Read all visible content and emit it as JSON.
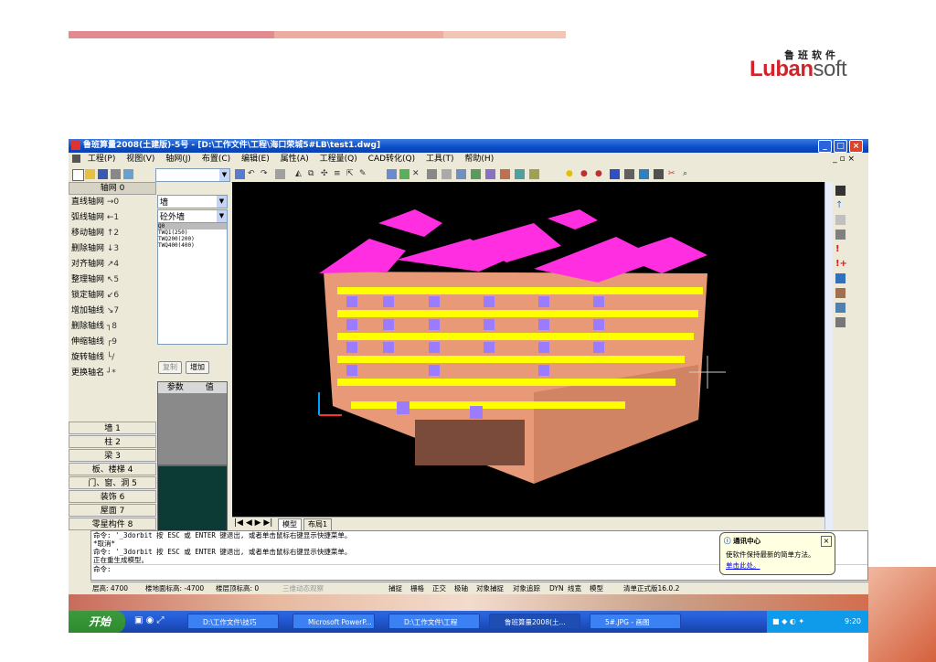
{
  "slide": {
    "logo_cn": "鲁班软件",
    "logo_en_bold": "Luban",
    "logo_en_light": "soft",
    "stripe_colors": [
      "#e0808a",
      "#eba8a0",
      "#f2c8b8",
      "#f6ddd0"
    ]
  },
  "window": {
    "title": "鲁班算量2008(土建版)-5号 - [D:\\工作文件\\工程\\海口荣城5#LB\\test1.dwg]",
    "controls": [
      "_",
      "□",
      "×"
    ]
  },
  "menu": [
    "工程(P)",
    "视图(V)",
    "轴网(J)",
    "布置(C)",
    "编辑(E)",
    "属性(A)",
    "工程量(Q)",
    "CAD转化(Q)",
    "工具(T)",
    "帮助(H)"
  ],
  "toolbar": {
    "layer_combo": ""
  },
  "left_panel": {
    "header": "轴网 0",
    "items": [
      {
        "label": "直线轴网",
        "key": "→0"
      },
      {
        "label": "弧线轴网",
        "key": "←1"
      },
      {
        "label": "移动轴网",
        "key": "↑2"
      },
      {
        "label": "删除轴网",
        "key": "↓3"
      },
      {
        "label": "对齐轴网",
        "key": "↗4"
      },
      {
        "label": "整理轴网",
        "key": "↖5"
      },
      {
        "label": "锁定轴网",
        "key": "↙6"
      },
      {
        "label": "增加轴线",
        "key": "↘7"
      },
      {
        "label": "删除轴线",
        "key": "┐8"
      },
      {
        "label": "伸缩轴线",
        "key": "┌9"
      },
      {
        "label": "旋转轴线",
        "key": "└/"
      },
      {
        "label": "更换轴名",
        "key": "┘*"
      }
    ],
    "categories": [
      "墙 1",
      "柱 2",
      "梁 3",
      "板、楼梯 4",
      "门、窗、洞 5",
      "装饰 6",
      "屋面 7",
      "零星构件 8"
    ]
  },
  "mid_panel": {
    "type_combo": "墙",
    "subtype_combo": "砼外墙",
    "list": [
      "Q0",
      "TWQ1(250)",
      "TWQ200(200)",
      "TWQ400(400)"
    ],
    "copy_button": "复制",
    "add_button": "增加",
    "table_headers": [
      "参数",
      "值"
    ]
  },
  "tabs": [
    "模型",
    "布局1"
  ],
  "command_lines": [
    "命令: '_3dorbit 按 ESC 或 ENTER 键退出, 或者单击鼠标右键显示快捷菜单。",
    "*取消*",
    "命令: '_3dorbit 按 ESC 或 ENTER 键退出, 或者单击鼠标右键显示快捷菜单。",
    "正在重生成模型。",
    "命令:"
  ],
  "balloon": {
    "title": "通讯中心",
    "text": "使软件保持最新的简单方法。",
    "link": "单击此处。"
  },
  "status": {
    "floor_height": "层高: 4700",
    "floor_elev": "楼地面标高: -4700",
    "top_elev": "楼层顶标高: 0",
    "hint": "三维动态观察",
    "toggles": [
      "捕捉",
      "栅格",
      "正交",
      "极轴",
      "对象捕捉",
      "对象追踪",
      "DYN",
      "线宽",
      "模型"
    ],
    "version": "清单正式版16.0.2"
  },
  "taskbar": {
    "start": "开始",
    "tasks": [
      "D:\\工作文件\\技巧",
      "Microsoft PowerP...",
      "D:\\工作文件\\工程",
      "鲁班算量2008(土...",
      "5#.JPG - 画图"
    ],
    "clock": "9:20"
  },
  "colors": {
    "roof": "#ff2ee0",
    "wall": "#e89a78",
    "window": "#ffff00",
    "glass": "#9b7cff"
  }
}
